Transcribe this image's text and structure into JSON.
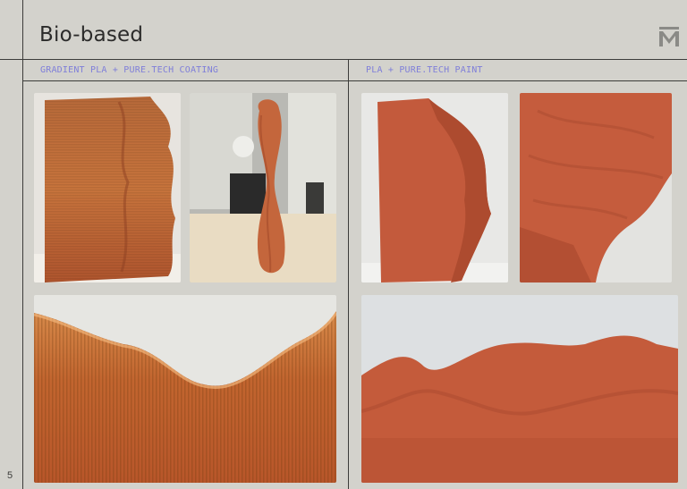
{
  "header": {
    "title": "Bio-based",
    "logo_icon": "m-brand-logo-icon"
  },
  "sections": [
    {
      "label": "GRADIENT PLA + PURE.TECH COATING"
    },
    {
      "label": "PLA + PURE.TECH PAINT"
    }
  ],
  "footer": {
    "page_number": "5"
  },
  "colors": {
    "background": "#d3d2cc",
    "rule": "#3c3c3a",
    "accent_label": "#7f7fd9",
    "terracotta": "#c4583a"
  }
}
